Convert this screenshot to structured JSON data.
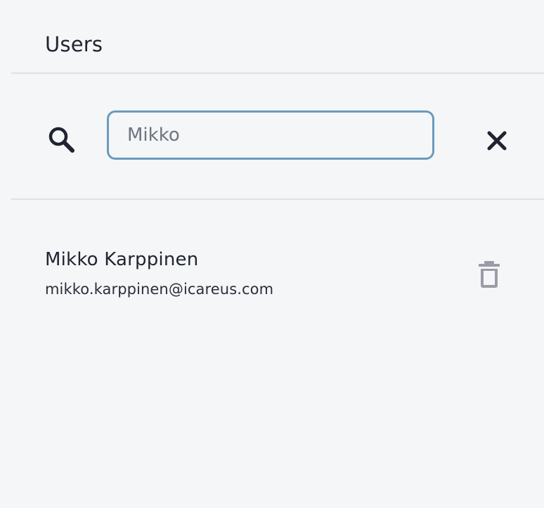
{
  "header": {
    "title": "Users"
  },
  "search": {
    "value": "Mikko",
    "icon": "search-icon",
    "clear_icon": "close-icon"
  },
  "users": [
    {
      "name": "Mikko Karppinen",
      "email": "mikko.karppinen@icareus.com",
      "action_icon": "trash-icon"
    }
  ],
  "colors": {
    "background": "#f5f6f8",
    "input_border": "#6a9bbd",
    "text": "#1f2430",
    "icon_dark": "#1f2430",
    "icon_muted": "#9a9ca6",
    "divider": "#dfe1e5"
  }
}
